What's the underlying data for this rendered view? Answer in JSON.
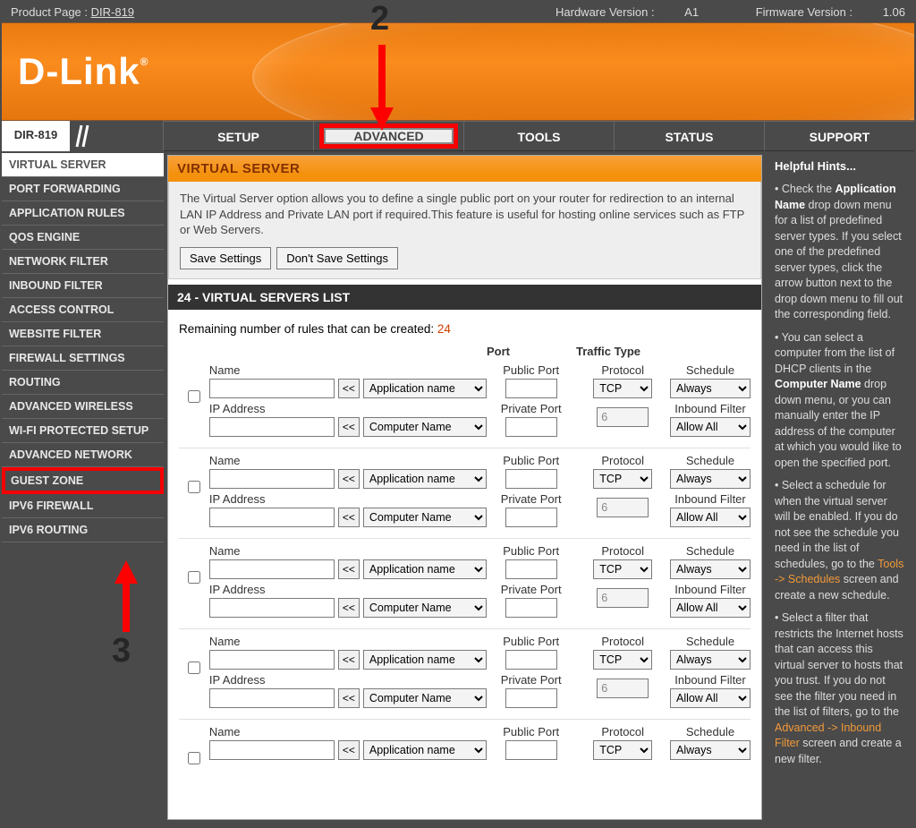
{
  "topbar": {
    "product_label": "Product Page : ",
    "product_value": "DIR-819",
    "hw_label": "Hardware Version : ",
    "hw_value": "A1",
    "fw_label": "Firmware Version : ",
    "fw_value": "1.06"
  },
  "brand": "D-Link",
  "brand_reg": "®",
  "model": "DIR-819",
  "tabs": [
    "SETUP",
    "ADVANCED",
    "TOOLS",
    "STATUS",
    "SUPPORT"
  ],
  "active_tab": "ADVANCED",
  "sidebar": {
    "items": [
      "VIRTUAL SERVER",
      "PORT FORWARDING",
      "APPLICATION RULES",
      "QOS ENGINE",
      "NETWORK FILTER",
      "INBOUND FILTER",
      "ACCESS CONTROL",
      "WEBSITE FILTER",
      "FIREWALL SETTINGS",
      "ROUTING",
      "ADVANCED WIRELESS",
      "WI-FI PROTECTED SETUP",
      "ADVANCED NETWORK",
      "GUEST ZONE",
      "IPV6 FIREWALL",
      "IPV6 ROUTING"
    ],
    "active": "VIRTUAL SERVER",
    "highlight": "GUEST ZONE"
  },
  "content": {
    "title": "VIRTUAL SERVER",
    "description": "The Virtual Server option allows you to define a single public port on your router for redirection to an internal LAN IP Address and Private LAN port if required.This feature is useful for hosting online services such as FTP or Web Servers.",
    "save": "Save Settings",
    "dont_save": "Don't Save Settings",
    "list_title": "24 - VIRTUAL SERVERS LIST",
    "remaining_label": "Remaining number of rules that can be created: ",
    "remaining_value": "24",
    "headers": {
      "port": "Port",
      "traffic": "Traffic Type"
    },
    "labels": {
      "name": "Name",
      "ip": "IP Address",
      "public_port": "Public Port",
      "private_port": "Private Port",
      "protocol": "Protocol",
      "schedule": "Schedule",
      "inbound_filter": "Inbound Filter",
      "arrow": "<<",
      "app_sel": "Application name",
      "comp_sel": "Computer Name",
      "proto_sel": "TCP",
      "proto_val": "6",
      "schedule_sel": "Always",
      "filter_sel": "Allow All"
    }
  },
  "hints": {
    "title": "Helpful Hints...",
    "p1a": "• Check the ",
    "p1b": "Application Name",
    "p1c": " drop down menu for a list of predefined server types. If you select one of the predefined server types, click the arrow button next to the drop down menu to fill out the corresponding field.",
    "p2a": "• You can select a computer from the list of DHCP clients in the ",
    "p2b": "Computer Name",
    "p2c": " drop down menu, or you can manually enter the IP address of the computer at which you would like to open the specified port.",
    "p3a": "• Select a schedule for when the virtual server will be enabled. If you do not see the schedule you need in the list of schedules, go to the ",
    "p3b": "Tools -> Schedules",
    "p3c": " screen and create a new schedule.",
    "p4a": "• Select a filter that restricts the Internet hosts that can access this virtual server to hosts that you trust. If you do not see the filter you need in the list of filters, go to the ",
    "p4b": "Advanced -> Inbound Filter",
    "p4c": " screen and create a new filter."
  },
  "annotations": {
    "num2": "2",
    "num3": "3"
  }
}
